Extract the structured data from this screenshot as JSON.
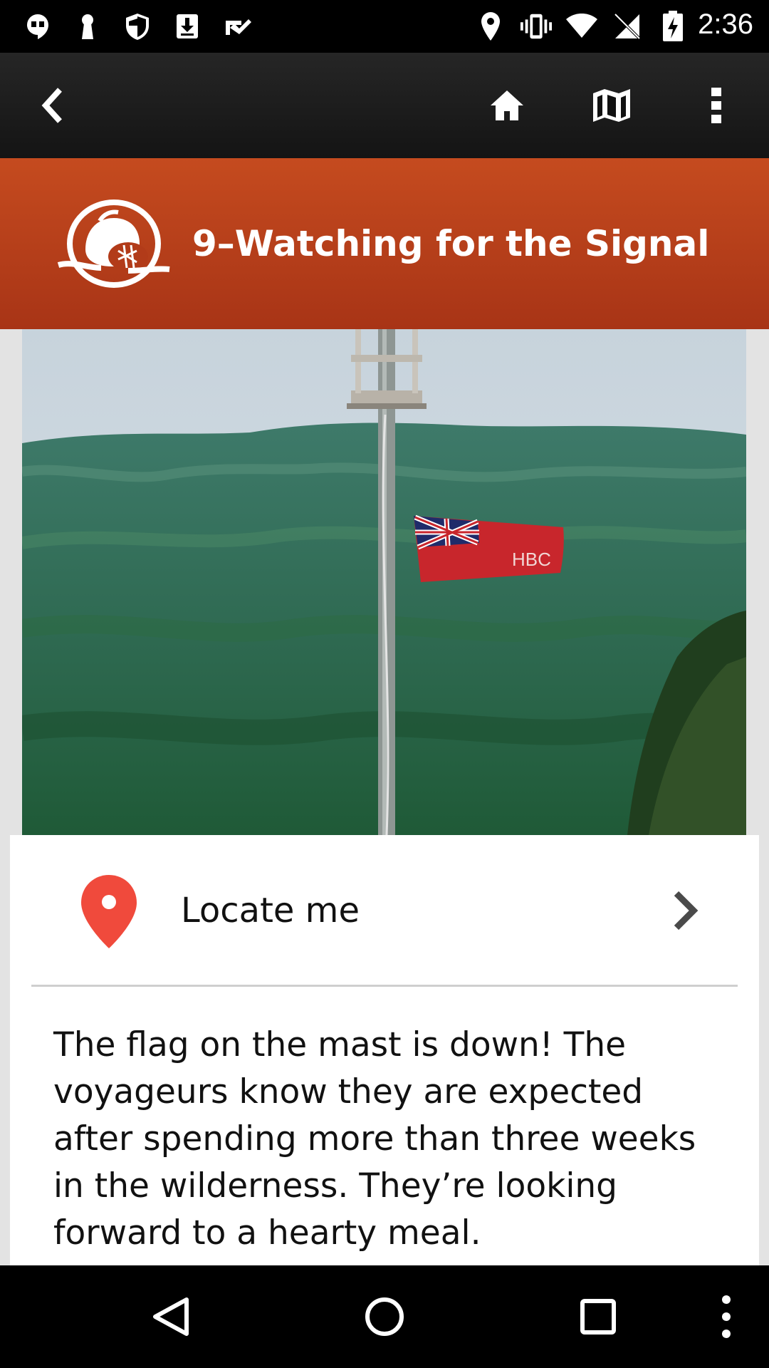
{
  "status_bar": {
    "time": "2:36",
    "left_icons": [
      "hangouts-icon",
      "keyhole-icon",
      "shield-icon",
      "download-icon",
      "check-icon"
    ],
    "right_icons": [
      "location-icon",
      "vibrate-icon",
      "wifi-icon",
      "no-signal-icon",
      "battery-charging-icon"
    ]
  },
  "toolbar": {
    "back_icon": "chevron-left-icon",
    "home_icon": "home-icon",
    "map_icon": "map-icon",
    "overflow_icon": "more-vert-icon"
  },
  "banner": {
    "title": "9–Watching for the Signal",
    "logo_icon": "beaver-logo-icon",
    "color_top": "#c54b1f",
    "color_bottom": "#a83416"
  },
  "photo": {
    "flag_text": "HBC"
  },
  "locate": {
    "label": "Locate me",
    "pin_color": "#f04a3c"
  },
  "description": "The flag on the mast is down! The voyageurs know they are expected after spending more than three weeks in the wilderness. They’re looking forward to a hearty meal.",
  "navbar": {
    "icons": [
      "back-triangle-icon",
      "home-circle-icon",
      "recents-square-icon",
      "more-dots-icon"
    ]
  }
}
